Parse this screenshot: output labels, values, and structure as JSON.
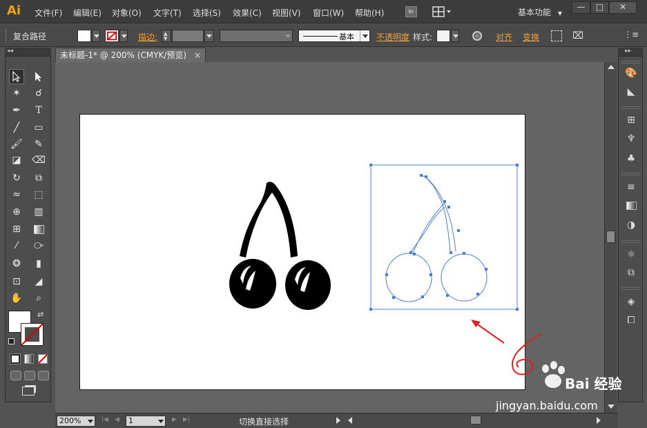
{
  "app": {
    "logo": "Ai",
    "menus": [
      "文件(F)",
      "编辑(E)",
      "对象(O)",
      "文字(T)",
      "选择(S)",
      "效果(C)",
      "视图(V)",
      "窗口(W)",
      "帮助(H)"
    ],
    "bridge_button": "Br",
    "workspace": "基本功能",
    "window_buttons": {
      "minimize": "—",
      "maximize": "□",
      "close": "✕"
    }
  },
  "control_bar": {
    "object_type": "复合路径",
    "stroke_link": "描边:",
    "stroke_style_label": "基本",
    "opacity_link": "不透明度",
    "style_label": "样式:",
    "align_link": "对齐",
    "transform_link": "变换"
  },
  "document": {
    "tab_title": "未标题-1* @ 200% (CMYK/预览)",
    "tab_close": "×"
  },
  "status_bar": {
    "zoom": "200%",
    "page": "1",
    "status_text": "切换直接选择"
  },
  "watermark": {
    "brand": "Bai 经验",
    "url": "jingyan.baidu.com"
  },
  "colors": {
    "accent": "#f1a20c",
    "link": "#f0a030",
    "selection": "#4a7fd0",
    "annotation": "#e02020"
  }
}
